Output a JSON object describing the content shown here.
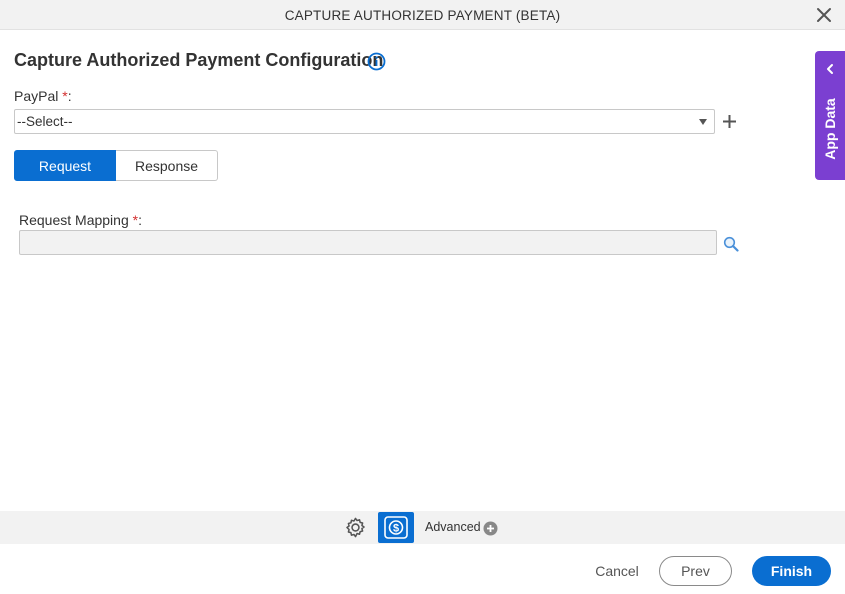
{
  "dialog": {
    "title": "CAPTURE AUTHORIZED PAYMENT (BETA)",
    "close_icon": "close-icon"
  },
  "page": {
    "heading": "Capture Authorized Payment Configuration",
    "info_icon": "info-icon"
  },
  "paypal": {
    "label": "PayPal",
    "required_mark": "*",
    "colon": ":",
    "selected": "--Select--",
    "add_icon": "plus-icon"
  },
  "tabs": [
    {
      "label": "Request",
      "active": true
    },
    {
      "label": "Response",
      "active": false
    }
  ],
  "request_mapping": {
    "label": "Request Mapping",
    "required_mark": "*",
    "colon": ":",
    "value": "",
    "search_icon": "search-icon"
  },
  "side_panel": {
    "label": "App Data",
    "icon": "chevron-left-icon"
  },
  "toolbar": {
    "advanced_label": "Advanced"
  },
  "footer": {
    "cancel_label": "Cancel",
    "prev_label": "Prev",
    "finish_label": "Finish"
  },
  "colors": {
    "primary": "#0a6ed1",
    "side_panel": "#7b3fd1",
    "required": "#d32f2f"
  }
}
